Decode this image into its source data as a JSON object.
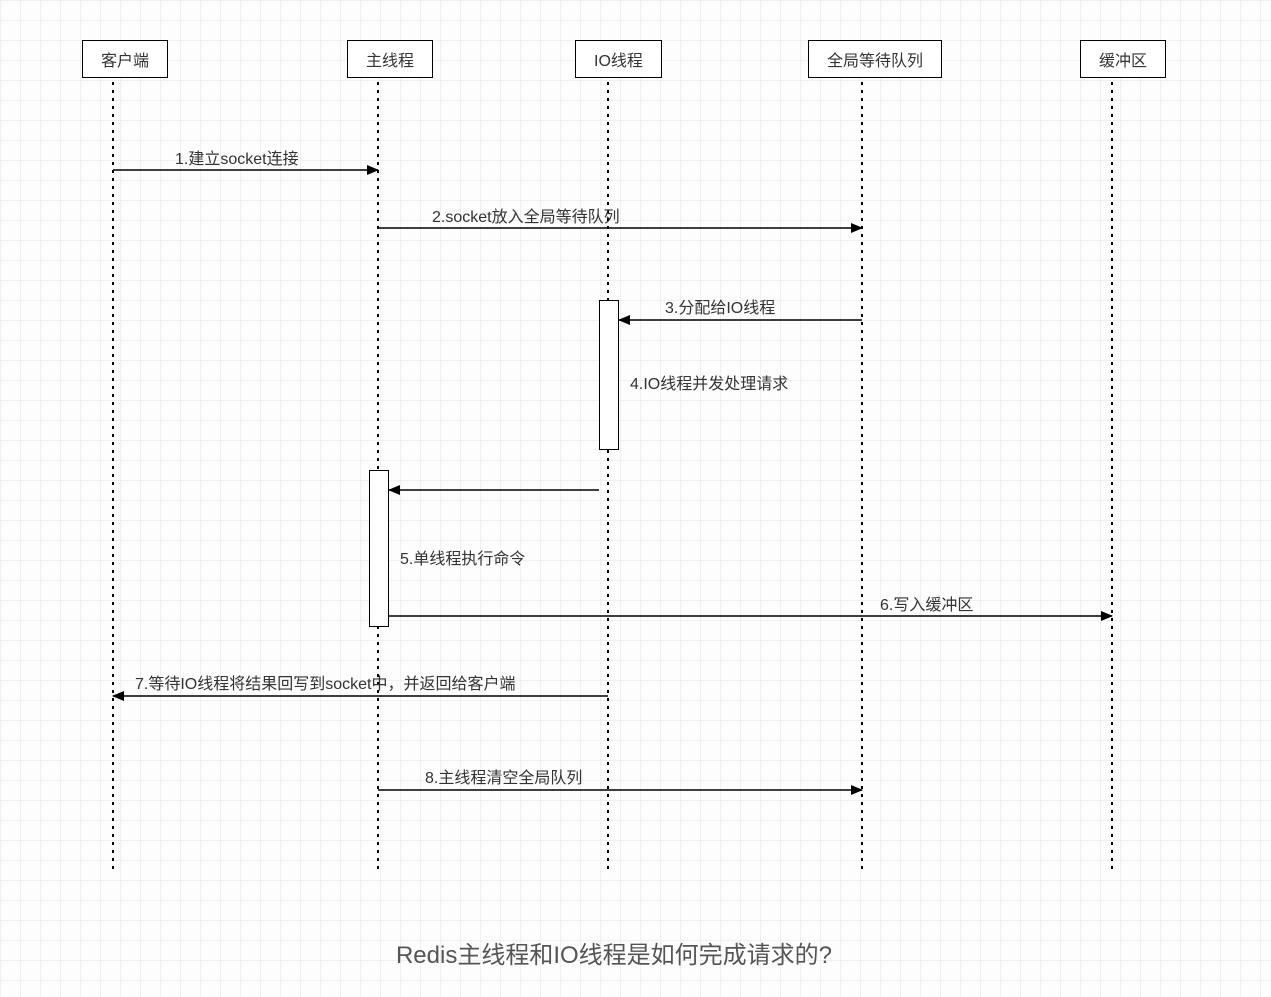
{
  "participants": {
    "client": "客户端",
    "main_thread": "主线程",
    "io_thread": "IO线程",
    "global_queue": "全局等待队列",
    "buffer": "缓冲区"
  },
  "messages": {
    "m1": "1.建立socket连接",
    "m2": "2.socket放入全局等待队列",
    "m3": "3.分配给IO线程",
    "m4": "4.IO线程并发处理请求",
    "m5": "5.单线程执行命令",
    "m6": "6.写入缓冲区",
    "m7": "7.等待IO线程将结果回写到socket中，并返回给客户端",
    "m8": "8.主线程清空全局队列"
  },
  "caption": "Redis主线程和IO线程是如何完成请求的?",
  "chart_data": {
    "type": "sequence_diagram",
    "participants": [
      "客户端",
      "主线程",
      "IO线程",
      "全局等待队列",
      "缓冲区"
    ],
    "interactions": [
      {
        "from": "客户端",
        "to": "主线程",
        "label": "1.建立socket连接",
        "dir": "right"
      },
      {
        "from": "主线程",
        "to": "全局等待队列",
        "label": "2.socket放入全局等待队列",
        "dir": "right"
      },
      {
        "from": "全局等待队列",
        "to": "IO线程",
        "label": "3.分配给IO线程",
        "dir": "left",
        "activates": "IO线程"
      },
      {
        "from": "IO线程",
        "to": "IO线程",
        "label": "4.IO线程并发处理请求",
        "note": true
      },
      {
        "from": "IO线程",
        "to": "主线程",
        "label": "",
        "dir": "left",
        "activates": "主线程"
      },
      {
        "from": "主线程",
        "to": "主线程",
        "label": "5.单线程执行命令",
        "note": true
      },
      {
        "from": "主线程",
        "to": "缓冲区",
        "label": "6.写入缓冲区",
        "dir": "right"
      },
      {
        "from": "IO线程",
        "to": "客户端",
        "label": "7.等待IO线程将结果回写到socket中，并返回给客户端",
        "dir": "left"
      },
      {
        "from": "主线程",
        "to": "全局等待队列",
        "label": "8.主线程清空全局队列",
        "dir": "right"
      }
    ],
    "title": "Redis主线程和IO线程是如何完成请求的?"
  }
}
